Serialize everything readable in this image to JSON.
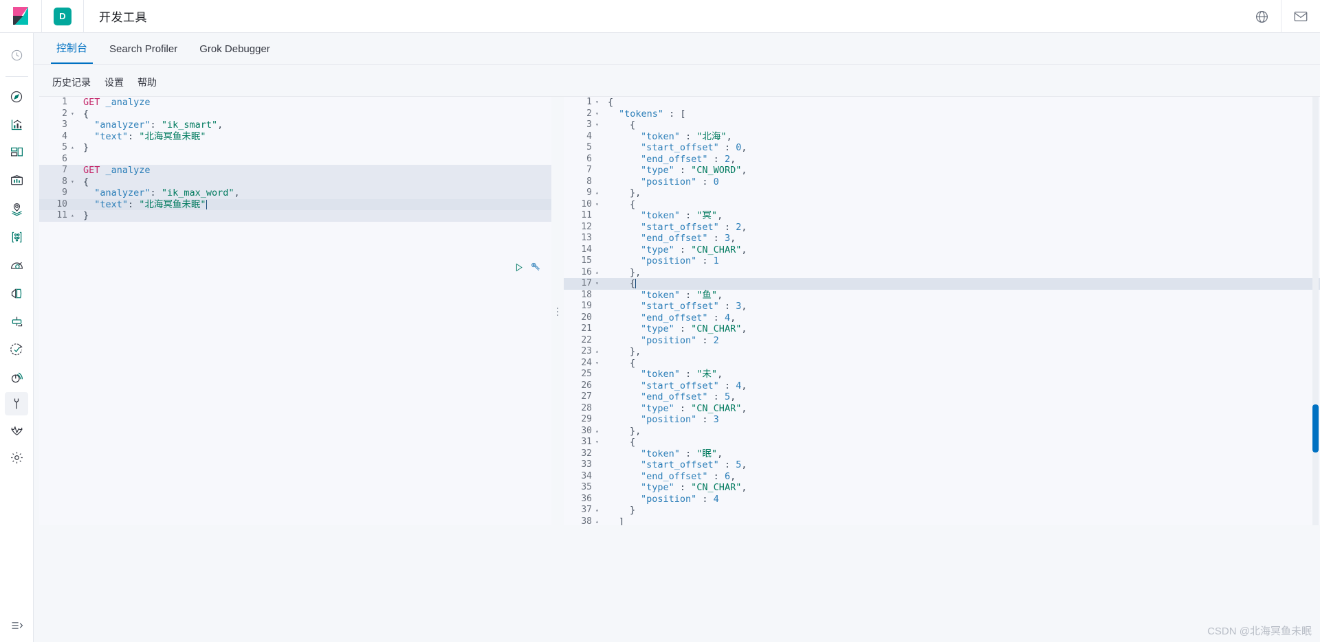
{
  "header": {
    "app_title": "开发工具",
    "space_badge": "D",
    "logo_name": "kibana-logo",
    "icons": [
      {
        "name": "help-globe-icon",
        "glyph": "?"
      },
      {
        "name": "mail-icon",
        "glyph": "✉"
      }
    ]
  },
  "rail": {
    "items": [
      {
        "name": "sidebar-item-recently-viewed",
        "icon": "clock-icon"
      },
      {
        "name": "sidebar-item-discover",
        "icon": "compass-icon"
      },
      {
        "name": "sidebar-item-visualize",
        "icon": "bar-chart-icon"
      },
      {
        "name": "sidebar-item-dashboard",
        "icon": "dashboard-icon"
      },
      {
        "name": "sidebar-item-canvas",
        "icon": "canvas-icon"
      },
      {
        "name": "sidebar-item-maps",
        "icon": "map-pin-layers-icon"
      },
      {
        "name": "sidebar-item-machine-learning",
        "icon": "machine-learning-icon"
      },
      {
        "name": "sidebar-item-infrastructure",
        "icon": "infrastructure-icon"
      },
      {
        "name": "sidebar-item-logs",
        "icon": "logs-icon"
      },
      {
        "name": "sidebar-item-apm",
        "icon": "apm-icon"
      },
      {
        "name": "sidebar-item-uptime",
        "icon": "uptime-icon"
      },
      {
        "name": "sidebar-item-siem",
        "icon": "siem-icon"
      },
      {
        "name": "sidebar-item-dev-tools",
        "icon": "wrench-icon",
        "active": true
      },
      {
        "name": "sidebar-item-monitoring",
        "icon": "heartbeat-icon"
      },
      {
        "name": "sidebar-item-management",
        "icon": "gear-icon"
      }
    ],
    "collapse": {
      "name": "collapse-nav-icon",
      "glyph": "⇥"
    }
  },
  "tabs": [
    {
      "label": "控制台",
      "active": true
    },
    {
      "label": "Search Profiler",
      "active": false
    },
    {
      "label": "Grok Debugger",
      "active": false
    }
  ],
  "console_menu": [
    {
      "label": "历史记录"
    },
    {
      "label": "设置"
    },
    {
      "label": "帮助"
    }
  ],
  "request_editor": {
    "lines": [
      {
        "n": "1",
        "fold": "",
        "segments": [
          {
            "t": "GET",
            "c": "kw"
          },
          {
            "t": " _analyze",
            "c": "key"
          }
        ]
      },
      {
        "n": "2",
        "fold": "▾",
        "segments": [
          {
            "t": "{",
            "c": "punct"
          }
        ]
      },
      {
        "n": "3",
        "fold": "",
        "segments": [
          {
            "t": "  \"analyzer\"",
            "c": "key"
          },
          {
            "t": ": ",
            "c": "punct"
          },
          {
            "t": "\"ik_smart\"",
            "c": "str"
          },
          {
            "t": ",",
            "c": "punct"
          }
        ]
      },
      {
        "n": "4",
        "fold": "",
        "segments": [
          {
            "t": "  \"text\"",
            "c": "key"
          },
          {
            "t": ": ",
            "c": "punct"
          },
          {
            "t": "\"北海冥鱼未眠\"",
            "c": "str"
          }
        ]
      },
      {
        "n": "5",
        "fold": "▴",
        "segments": [
          {
            "t": "}",
            "c": "punct"
          }
        ]
      },
      {
        "n": "6",
        "fold": "",
        "segments": []
      },
      {
        "n": "7",
        "fold": "",
        "segments": [
          {
            "t": "GET",
            "c": "kw"
          },
          {
            "t": " _analyze",
            "c": "key"
          }
        ],
        "highlight": true
      },
      {
        "n": "8",
        "fold": "▾",
        "segments": [
          {
            "t": "{",
            "c": "punct"
          }
        ],
        "highlight": true
      },
      {
        "n": "9",
        "fold": "",
        "segments": [
          {
            "t": "  \"analyzer\"",
            "c": "key"
          },
          {
            "t": ": ",
            "c": "punct"
          },
          {
            "t": "\"ik_max_word\"",
            "c": "str"
          },
          {
            "t": ",",
            "c": "punct"
          }
        ],
        "highlight": true
      },
      {
        "n": "10",
        "fold": "",
        "segments": [
          {
            "t": "  \"text\"",
            "c": "key"
          },
          {
            "t": ": ",
            "c": "punct"
          },
          {
            "t": "\"北海冥鱼未眠\"",
            "c": "str"
          }
        ],
        "cursor": true
      },
      {
        "n": "11",
        "fold": "▴",
        "segments": [
          {
            "t": "}",
            "c": "punct"
          }
        ],
        "highlight": true
      }
    ],
    "actions": [
      {
        "name": "send-request-play-button",
        "icon": "play-triangle-icon"
      },
      {
        "name": "request-options-wrench-button",
        "icon": "wrench-icon"
      }
    ]
  },
  "response_editor": {
    "lines": [
      {
        "n": "1",
        "fold": "▾",
        "indent": 0,
        "segments": [
          {
            "t": "{",
            "c": "punct"
          }
        ]
      },
      {
        "n": "2",
        "fold": "▾",
        "indent": 1,
        "segments": [
          {
            "t": "\"tokens\"",
            "c": "key"
          },
          {
            "t": " : ",
            "c": "punct"
          },
          {
            "t": "[",
            "c": "punct"
          }
        ]
      },
      {
        "n": "3",
        "fold": "▾",
        "indent": 2,
        "segments": [
          {
            "t": "{",
            "c": "punct"
          }
        ]
      },
      {
        "n": "4",
        "fold": "",
        "indent": 3,
        "segments": [
          {
            "t": "\"token\"",
            "c": "key"
          },
          {
            "t": " : ",
            "c": "punct"
          },
          {
            "t": "\"北海\"",
            "c": "str"
          },
          {
            "t": ",",
            "c": "punct"
          }
        ]
      },
      {
        "n": "5",
        "fold": "",
        "indent": 3,
        "segments": [
          {
            "t": "\"start_offset\"",
            "c": "key"
          },
          {
            "t": " : ",
            "c": "punct"
          },
          {
            "t": "0",
            "c": "num0"
          },
          {
            "t": ",",
            "c": "punct"
          }
        ]
      },
      {
        "n": "6",
        "fold": "",
        "indent": 3,
        "segments": [
          {
            "t": "\"end_offset\"",
            "c": "key"
          },
          {
            "t": " : ",
            "c": "punct"
          },
          {
            "t": "2",
            "c": "num0"
          },
          {
            "t": ",",
            "c": "punct"
          }
        ]
      },
      {
        "n": "7",
        "fold": "",
        "indent": 3,
        "segments": [
          {
            "t": "\"type\"",
            "c": "key"
          },
          {
            "t": " : ",
            "c": "punct"
          },
          {
            "t": "\"CN_WORD\"",
            "c": "str"
          },
          {
            "t": ",",
            "c": "punct"
          }
        ]
      },
      {
        "n": "8",
        "fold": "",
        "indent": 3,
        "segments": [
          {
            "t": "\"position\"",
            "c": "key"
          },
          {
            "t": " : ",
            "c": "punct"
          },
          {
            "t": "0",
            "c": "num0"
          }
        ]
      },
      {
        "n": "9",
        "fold": "▴",
        "indent": 2,
        "segments": [
          {
            "t": "},",
            "c": "punct"
          }
        ]
      },
      {
        "n": "10",
        "fold": "▾",
        "indent": 2,
        "segments": [
          {
            "t": "{",
            "c": "punct"
          }
        ]
      },
      {
        "n": "11",
        "fold": "",
        "indent": 3,
        "segments": [
          {
            "t": "\"token\"",
            "c": "key"
          },
          {
            "t": " : ",
            "c": "punct"
          },
          {
            "t": "\"冥\"",
            "c": "str"
          },
          {
            "t": ",",
            "c": "punct"
          }
        ]
      },
      {
        "n": "12",
        "fold": "",
        "indent": 3,
        "segments": [
          {
            "t": "\"start_offset\"",
            "c": "key"
          },
          {
            "t": " : ",
            "c": "punct"
          },
          {
            "t": "2",
            "c": "num0"
          },
          {
            "t": ",",
            "c": "punct"
          }
        ]
      },
      {
        "n": "13",
        "fold": "",
        "indent": 3,
        "segments": [
          {
            "t": "\"end_offset\"",
            "c": "key"
          },
          {
            "t": " : ",
            "c": "punct"
          },
          {
            "t": "3",
            "c": "num0"
          },
          {
            "t": ",",
            "c": "punct"
          }
        ]
      },
      {
        "n": "14",
        "fold": "",
        "indent": 3,
        "segments": [
          {
            "t": "\"type\"",
            "c": "key"
          },
          {
            "t": " : ",
            "c": "punct"
          },
          {
            "t": "\"CN_CHAR\"",
            "c": "str"
          },
          {
            "t": ",",
            "c": "punct"
          }
        ]
      },
      {
        "n": "15",
        "fold": "",
        "indent": 3,
        "segments": [
          {
            "t": "\"position\"",
            "c": "key"
          },
          {
            "t": " : ",
            "c": "punct"
          },
          {
            "t": "1",
            "c": "num0"
          }
        ]
      },
      {
        "n": "16",
        "fold": "▴",
        "indent": 2,
        "segments": [
          {
            "t": "},",
            "c": "punct"
          }
        ]
      },
      {
        "n": "17",
        "fold": "▾",
        "indent": 2,
        "segments": [
          {
            "t": "{",
            "c": "punct"
          }
        ],
        "cursor": true
      },
      {
        "n": "18",
        "fold": "",
        "indent": 3,
        "segments": [
          {
            "t": "\"token\"",
            "c": "key"
          },
          {
            "t": " : ",
            "c": "punct"
          },
          {
            "t": "\"鱼\"",
            "c": "str"
          },
          {
            "t": ",",
            "c": "punct"
          }
        ]
      },
      {
        "n": "19",
        "fold": "",
        "indent": 3,
        "segments": [
          {
            "t": "\"start_offset\"",
            "c": "key"
          },
          {
            "t": " : ",
            "c": "punct"
          },
          {
            "t": "3",
            "c": "num0"
          },
          {
            "t": ",",
            "c": "punct"
          }
        ]
      },
      {
        "n": "20",
        "fold": "",
        "indent": 3,
        "segments": [
          {
            "t": "\"end_offset\"",
            "c": "key"
          },
          {
            "t": " : ",
            "c": "punct"
          },
          {
            "t": "4",
            "c": "num0"
          },
          {
            "t": ",",
            "c": "punct"
          }
        ]
      },
      {
        "n": "21",
        "fold": "",
        "indent": 3,
        "segments": [
          {
            "t": "\"type\"",
            "c": "key"
          },
          {
            "t": " : ",
            "c": "punct"
          },
          {
            "t": "\"CN_CHAR\"",
            "c": "str"
          },
          {
            "t": ",",
            "c": "punct"
          }
        ]
      },
      {
        "n": "22",
        "fold": "",
        "indent": 3,
        "segments": [
          {
            "t": "\"position\"",
            "c": "key"
          },
          {
            "t": " : ",
            "c": "punct"
          },
          {
            "t": "2",
            "c": "num0"
          }
        ]
      },
      {
        "n": "23",
        "fold": "▴",
        "indent": 2,
        "segments": [
          {
            "t": "},",
            "c": "punct"
          }
        ]
      },
      {
        "n": "24",
        "fold": "▾",
        "indent": 2,
        "segments": [
          {
            "t": "{",
            "c": "punct"
          }
        ]
      },
      {
        "n": "25",
        "fold": "",
        "indent": 3,
        "segments": [
          {
            "t": "\"token\"",
            "c": "key"
          },
          {
            "t": " : ",
            "c": "punct"
          },
          {
            "t": "\"未\"",
            "c": "str"
          },
          {
            "t": ",",
            "c": "punct"
          }
        ]
      },
      {
        "n": "26",
        "fold": "",
        "indent": 3,
        "segments": [
          {
            "t": "\"start_offset\"",
            "c": "key"
          },
          {
            "t": " : ",
            "c": "punct"
          },
          {
            "t": "4",
            "c": "num0"
          },
          {
            "t": ",",
            "c": "punct"
          }
        ]
      },
      {
        "n": "27",
        "fold": "",
        "indent": 3,
        "segments": [
          {
            "t": "\"end_offset\"",
            "c": "key"
          },
          {
            "t": " : ",
            "c": "punct"
          },
          {
            "t": "5",
            "c": "num0"
          },
          {
            "t": ",",
            "c": "punct"
          }
        ]
      },
      {
        "n": "28",
        "fold": "",
        "indent": 3,
        "segments": [
          {
            "t": "\"type\"",
            "c": "key"
          },
          {
            "t": " : ",
            "c": "punct"
          },
          {
            "t": "\"CN_CHAR\"",
            "c": "str"
          },
          {
            "t": ",",
            "c": "punct"
          }
        ]
      },
      {
        "n": "29",
        "fold": "",
        "indent": 3,
        "segments": [
          {
            "t": "\"position\"",
            "c": "key"
          },
          {
            "t": " : ",
            "c": "punct"
          },
          {
            "t": "3",
            "c": "num0"
          }
        ]
      },
      {
        "n": "30",
        "fold": "▴",
        "indent": 2,
        "segments": [
          {
            "t": "},",
            "c": "punct"
          }
        ]
      },
      {
        "n": "31",
        "fold": "▾",
        "indent": 2,
        "segments": [
          {
            "t": "{",
            "c": "punct"
          }
        ]
      },
      {
        "n": "32",
        "fold": "",
        "indent": 3,
        "segments": [
          {
            "t": "\"token\"",
            "c": "key"
          },
          {
            "t": " : ",
            "c": "punct"
          },
          {
            "t": "\"眠\"",
            "c": "str"
          },
          {
            "t": ",",
            "c": "punct"
          }
        ]
      },
      {
        "n": "33",
        "fold": "",
        "indent": 3,
        "segments": [
          {
            "t": "\"start_offset\"",
            "c": "key"
          },
          {
            "t": " : ",
            "c": "punct"
          },
          {
            "t": "5",
            "c": "num0"
          },
          {
            "t": ",",
            "c": "punct"
          }
        ]
      },
      {
        "n": "34",
        "fold": "",
        "indent": 3,
        "segments": [
          {
            "t": "\"end_offset\"",
            "c": "key"
          },
          {
            "t": " : ",
            "c": "punct"
          },
          {
            "t": "6",
            "c": "num0"
          },
          {
            "t": ",",
            "c": "punct"
          }
        ]
      },
      {
        "n": "35",
        "fold": "",
        "indent": 3,
        "segments": [
          {
            "t": "\"type\"",
            "c": "key"
          },
          {
            "t": " : ",
            "c": "punct"
          },
          {
            "t": "\"CN_CHAR\"",
            "c": "str"
          },
          {
            "t": ",",
            "c": "punct"
          }
        ]
      },
      {
        "n": "36",
        "fold": "",
        "indent": 3,
        "segments": [
          {
            "t": "\"position\"",
            "c": "key"
          },
          {
            "t": " : ",
            "c": "punct"
          },
          {
            "t": "4",
            "c": "num0"
          }
        ]
      },
      {
        "n": "37",
        "fold": "▴",
        "indent": 2,
        "segments": [
          {
            "t": "}",
            "c": "punct"
          }
        ]
      },
      {
        "n": "38",
        "fold": "▴",
        "indent": 1,
        "segments": [
          {
            "t": "]",
            "c": "punct"
          }
        ]
      }
    ]
  },
  "watermark": "CSDN @北海冥鱼未眠",
  "colors": {
    "accent": "#0071c2",
    "space_badge_bg": "#02a79c",
    "keyword": "#c4286a",
    "string": "#007a5e",
    "key": "#2b7eb8",
    "highlight_row": "#e4e8f1",
    "page_bg": "#f5f7fa"
  }
}
